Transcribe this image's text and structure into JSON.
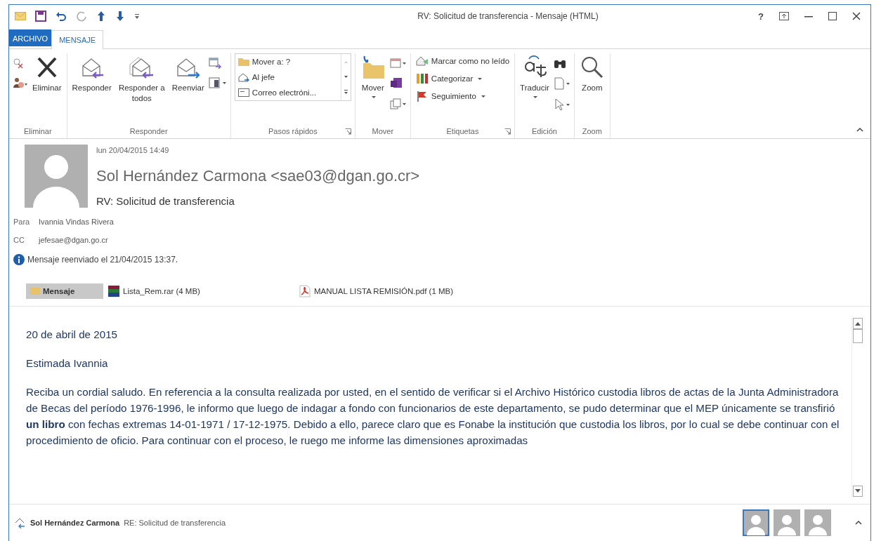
{
  "window": {
    "title": "RV: Solicitud de transferencia - Mensaje (HTML)",
    "help": "?"
  },
  "tabs": [
    {
      "label": "ARCHIVO",
      "kind": "file",
      "selected": false
    },
    {
      "label": "MENSAJE",
      "kind": "tab",
      "selected": true
    }
  ],
  "ribbon": {
    "groups": [
      {
        "name": "Eliminar",
        "large": [
          {
            "label": "Eliminar"
          }
        ]
      },
      {
        "name": "Responder",
        "large": [
          {
            "label": "Responder"
          },
          {
            "label": "Responder a todos"
          },
          {
            "label": "Reenviar"
          }
        ]
      },
      {
        "name": "Pasos rápidos",
        "gallery": [
          "Mover a: ?",
          "Al jefe",
          "Correo electróni..."
        ],
        "launcher": true
      },
      {
        "name": "Mover",
        "large": [
          {
            "label": "Mover"
          }
        ]
      },
      {
        "name": "Etiquetas",
        "small": [
          {
            "label": "Marcar como no leído"
          },
          {
            "label": "Categorizar",
            "dropdown": true
          },
          {
            "label": "Seguimiento",
            "dropdown": true
          }
        ],
        "launcher": true
      },
      {
        "name": "Edición",
        "large": [
          {
            "label": "Traducir"
          }
        ]
      },
      {
        "name": "Zoom",
        "large": [
          {
            "label": "Zoom"
          }
        ]
      }
    ]
  },
  "message": {
    "date": "lun 20/04/2015 14:49",
    "sender": "Sol Hernández Carmona <sae03@dgan.go.cr>",
    "subject": "RV: Solicitud de transferencia",
    "recipients": [
      {
        "label": "Para",
        "value": "Ivannia Vindas Rivera"
      },
      {
        "label": "CC",
        "value": "jefesae@dgan.go.cr"
      }
    ],
    "info": "Mensaje reenviado el 21/04/2015 13:37.",
    "attachments": [
      {
        "label": "Mensaje",
        "kind": "message",
        "selected": true
      },
      {
        "label": "Lista_Rem.rar (4 MB)",
        "kind": "rar",
        "selected": false
      },
      {
        "label": "MANUAL LISTA REMISIÓN.pdf (1 MB)",
        "kind": "pdf",
        "selected": false
      }
    ],
    "body": [
      "20 de abril de 2015",
      "Estimada Ivannia",
      "Reciba un cordial saludo. En referencia a la consulta realizada por usted, en el sentido de verificar si el Archivo Histórico custodia libros de actas de la Junta Administradora de Becas del período 1976-1996, le informo que luego de indagar a fondo con funcionarios de este departamento, se pudo determinar que el MEP únicamente se transfirió **un libro** con fechas extremas 14-01-1971 / 17-12-1975. Debido a ello, parece claro que es Fonabe la institución que custodia los libros, por lo cual se debe continuar con el procedimiento de oficio.  Para continuar con el proceso, le ruego me informe las dimensiones aproximadas"
    ]
  },
  "people_pane": {
    "name": "Sol Hernández Carmona",
    "subject": "RE: Solicitud de transferencia",
    "avatars": [
      {
        "selected": true
      },
      {
        "selected": false
      },
      {
        "selected": false
      }
    ]
  }
}
